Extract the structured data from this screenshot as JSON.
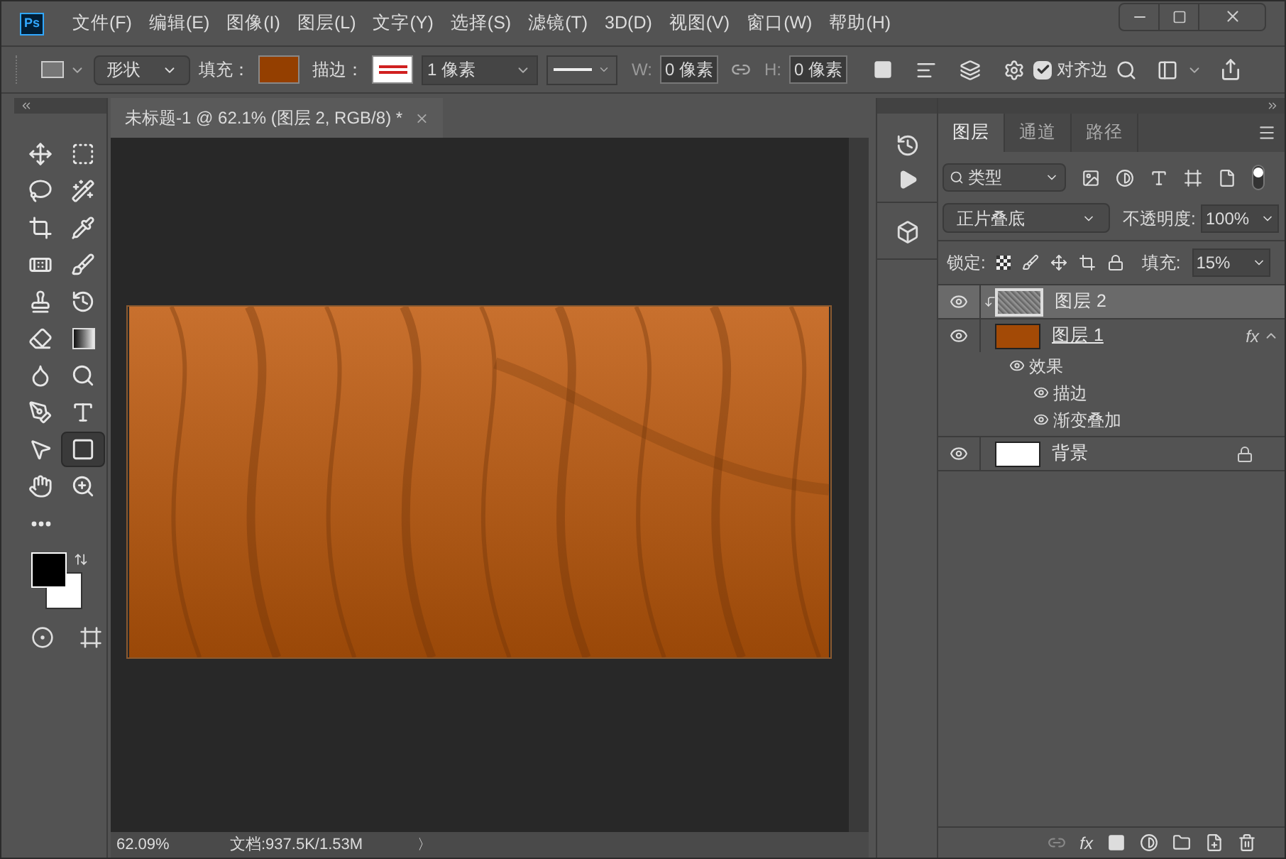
{
  "app": {
    "logo": "Ps"
  },
  "menu": [
    "文件(F)",
    "编辑(E)",
    "图像(I)",
    "图层(L)",
    "文字(Y)",
    "选择(S)",
    "滤镜(T)",
    "3D(D)",
    "视图(V)",
    "窗口(W)",
    "帮助(H)"
  ],
  "options_bar": {
    "mode": "形状",
    "fill_label": "填充：",
    "stroke_label": "描边：",
    "stroke_width": "1 像素",
    "w_label": "W:",
    "w_value": "0 像素",
    "h_label": "H:",
    "h_value": "0 像素",
    "align_edges": {
      "label": "对齐边",
      "checked": true
    }
  },
  "document_tab": {
    "title": "未标题-1 @ 62.1% (图层 2, RGB/8) *"
  },
  "tools": [
    {
      "kind": "move",
      "selected": false
    },
    {
      "kind": "marquee",
      "selected": false
    },
    {
      "kind": "lasso",
      "selected": false
    },
    {
      "kind": "quick-select",
      "selected": false
    },
    {
      "kind": "crop",
      "selected": false
    },
    {
      "kind": "eyedropper",
      "selected": false
    },
    {
      "kind": "healing",
      "selected": false
    },
    {
      "kind": "brush",
      "selected": false
    },
    {
      "kind": "stamp",
      "selected": false
    },
    {
      "kind": "history-brush",
      "selected": false
    },
    {
      "kind": "eraser",
      "selected": false
    },
    {
      "kind": "gradient",
      "selected": false
    },
    {
      "kind": "blur",
      "selected": false
    },
    {
      "kind": "dodge",
      "selected": false
    },
    {
      "kind": "pen",
      "selected": false
    },
    {
      "kind": "type",
      "selected": false
    },
    {
      "kind": "path-select",
      "selected": false
    },
    {
      "kind": "rectangle",
      "selected": true
    },
    {
      "kind": "hand",
      "selected": false
    },
    {
      "kind": "zoom",
      "selected": false
    },
    {
      "kind": "more",
      "selected": false
    }
  ],
  "status_bar": {
    "zoom": "62.09%",
    "document": "文档:937.5K/1.53M",
    "arrow": "〉"
  },
  "layers_panel": {
    "tabs": [
      {
        "label": "图层",
        "selected": true
      },
      {
        "label": "通道",
        "selected": false
      },
      {
        "label": "路径",
        "selected": false
      }
    ],
    "filter": "类型",
    "blend_mode": "正片叠底",
    "opacity_label": "不透明度:",
    "opacity": "100%",
    "lock_label": "锁定:",
    "fill_label": "填充:",
    "fill": "15%",
    "layers": [
      {
        "name": "图层 2",
        "kind": "noise",
        "selected": true,
        "visible": true,
        "clipped": true
      },
      {
        "name": "图层 1",
        "kind": "solid",
        "selected": false,
        "visible": true,
        "fx_badge": "fx",
        "effects": {
          "label": "效果",
          "children": [
            {
              "name": "描边"
            },
            {
              "name": "渐变叠加"
            }
          ]
        }
      },
      {
        "name": "背景",
        "kind": "white",
        "selected": false,
        "visible": true,
        "locked": true
      }
    ],
    "footer": {
      "add_style": "fx"
    }
  }
}
